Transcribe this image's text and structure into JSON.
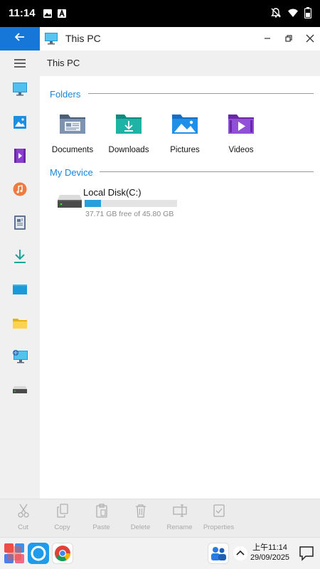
{
  "status_bar": {
    "time": "11:14",
    "left_icons": [
      "image-icon",
      "a-badge-icon"
    ],
    "right_icons": [
      "notifications-off-icon",
      "wifi-icon",
      "battery-icon"
    ]
  },
  "window": {
    "title": "This PC",
    "accent_color": "#1677d9"
  },
  "sidebar": {
    "items": [
      {
        "name": "menu-icon"
      },
      {
        "name": "this-pc-icon"
      },
      {
        "name": "pictures-icon"
      },
      {
        "name": "videos-icon"
      },
      {
        "name": "music-icon"
      },
      {
        "name": "documents-icon"
      },
      {
        "name": "downloads-icon"
      },
      {
        "name": "desktop-icon"
      },
      {
        "name": "folder-icon"
      },
      {
        "name": "network-icon"
      },
      {
        "name": "drive-icon"
      }
    ]
  },
  "path": "This PC",
  "sections": {
    "folders_title": "Folders",
    "device_title": "My Device"
  },
  "folders": [
    {
      "label": "Documents",
      "icon": "documents-folder-icon"
    },
    {
      "label": "Downloads",
      "icon": "downloads-folder-icon"
    },
    {
      "label": "Pictures",
      "icon": "pictures-folder-icon"
    },
    {
      "label": "Videos",
      "icon": "videos-folder-icon"
    }
  ],
  "device": {
    "name": "Local Disk(C:)",
    "free_text": "37.71 GB free of 45.80 GB",
    "used_fraction": 0.177
  },
  "toolbar": {
    "cut": "Cut",
    "copy": "Copy",
    "paste": "Paste",
    "delete": "Delete",
    "rename": "Rename",
    "properties": "Properties"
  },
  "taskbar": {
    "time": "上午11:14",
    "date": "29/09/2025"
  }
}
